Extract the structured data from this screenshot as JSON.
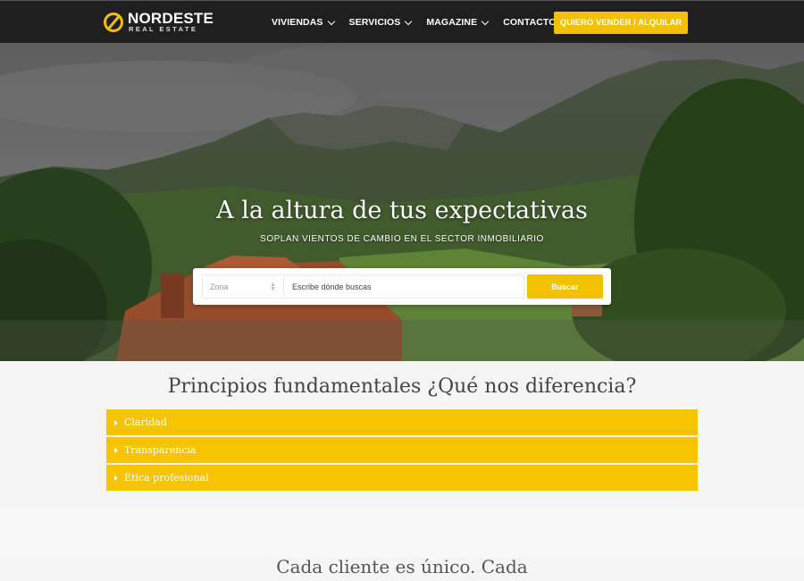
{
  "brand": {
    "name": "NORDESTE",
    "tagline": "REAL ESTATE",
    "accent": "#f2c200"
  },
  "nav": {
    "items": [
      {
        "label": "VIVIENDAS"
      },
      {
        "label": "SERVICIOS"
      },
      {
        "label": "MAGAZINE"
      },
      {
        "label": "CONTACTO"
      }
    ],
    "cta_label": "QUIERO VENDER / ALQUILAR"
  },
  "hero": {
    "title": "A la altura de tus expectativas",
    "subtitle": "SOPLAN VIENTOS DE CAMBIO EN EL SECTOR INMOBILIARIO"
  },
  "search": {
    "zone_value": "Zona",
    "where_value": "Escribe dónde buscas",
    "button_label": "Buscar"
  },
  "principles": {
    "title": "Principios fundamentales ¿Qué nos diferencia?",
    "items": [
      {
        "label": "Claridad"
      },
      {
        "label": "Transparencia"
      },
      {
        "label": "Ética profesional"
      }
    ]
  },
  "bottom": {
    "text": "Cada cliente es único. Cada"
  }
}
